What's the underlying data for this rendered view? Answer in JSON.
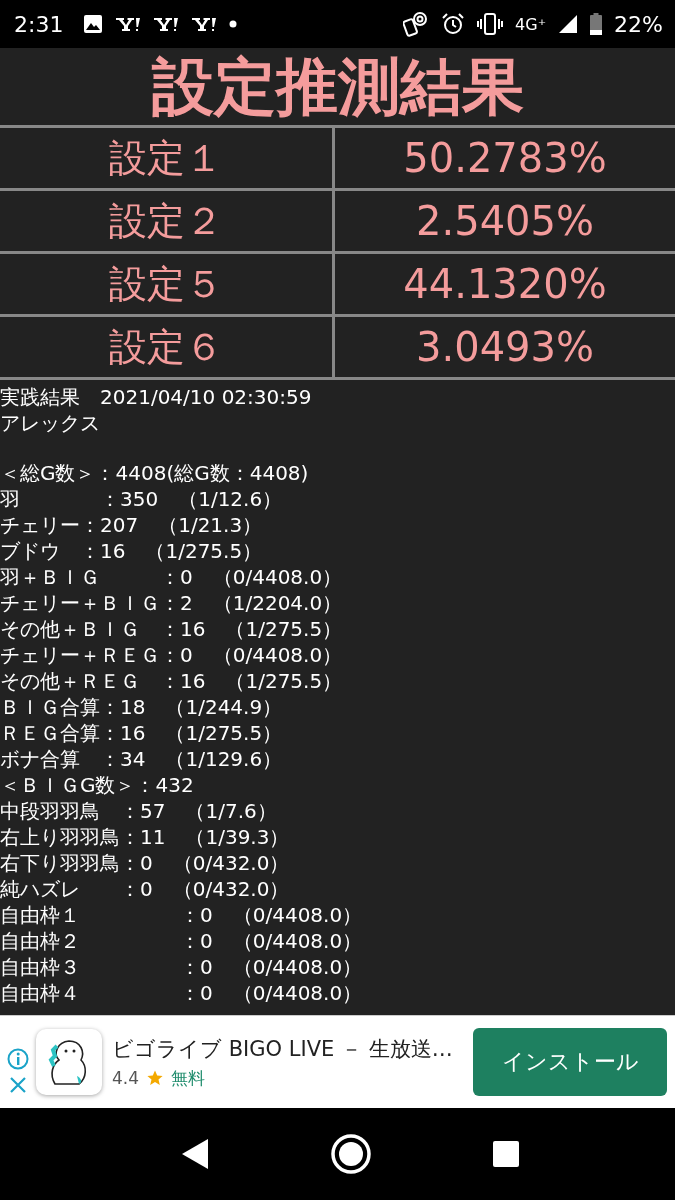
{
  "status_bar": {
    "time": "2:31",
    "network": "4G⁺",
    "battery": "22%"
  },
  "title": "設定推測結果",
  "settings": [
    {
      "label": "設定１",
      "value": "50.2783%"
    },
    {
      "label": "設定２",
      "value": "2.5405%"
    },
    {
      "label": "設定５",
      "value": "44.1320%"
    },
    {
      "label": "設定６",
      "value": "3.0493%"
    }
  ],
  "result_header": [
    "実践結果　2021/04/10 02:30:59",
    "アレックス"
  ],
  "result_lines": [
    "＜総G数＞：4408(総G数：4408)",
    "羽　　　　：350　（1/12.6）",
    "チェリー：207　（1/21.3）",
    "ブドウ　：16　（1/275.5）",
    "羽＋ＢＩＧ　　　：0　（0/4408.0）",
    "チェリー＋ＢＩＧ：2　（1/2204.0）",
    "その他＋ＢＩＧ　：16　（1/275.5）",
    "チェリー＋ＲＥＧ：0　（0/4408.0）",
    "その他＋ＲＥＧ　：16　（1/275.5）",
    "ＢＩＧ合算：18　（1/244.9）",
    "ＲＥＧ合算：16　（1/275.5）",
    "ボナ合算　：34　（1/129.6）",
    "＜ＢＩＧG数＞：432",
    "中段羽羽鳥　：57　（1/7.6）",
    "右上り羽羽鳥：11　（1/39.3）",
    "右下り羽羽鳥：0　（0/432.0）",
    "純ハズレ　　：0　（0/432.0）",
    "自由枠１　　　　　：0　（0/4408.0）",
    "自由枠２　　　　　：0　（0/4408.0）",
    "自由枠３　　　　　：0　（0/4408.0）",
    "自由枠４　　　　　：0　（0/4408.0）"
  ],
  "ad": {
    "title": "ビゴライブ BIGO LIVE － 生放送…",
    "rating": "4.4",
    "price": "無料",
    "button": "インストール"
  }
}
